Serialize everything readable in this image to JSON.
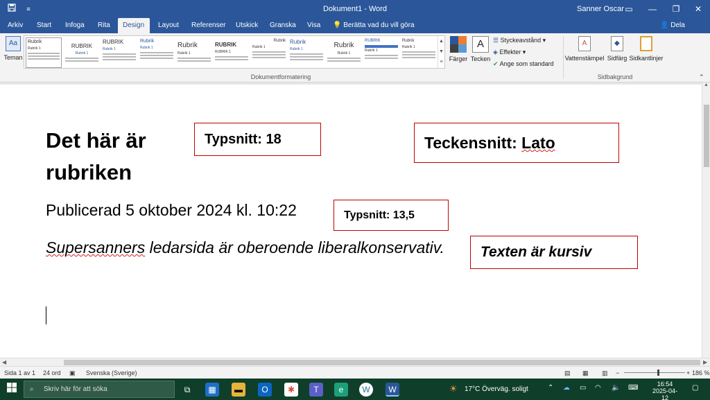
{
  "window": {
    "title": "Dokument1 - Word",
    "user": "Sanner Oscar",
    "icons": {
      "save": "save-icon",
      "customize": "chevron-down-icon"
    }
  },
  "tabs": [
    "Arkiv",
    "Start",
    "Infoga",
    "Rita",
    "Design",
    "Layout",
    "Referenser",
    "Utskick",
    "Granska",
    "Visa"
  ],
  "active_tab": "Design",
  "tell_me": "Berätta vad du vill göra",
  "share": "Dela",
  "ribbon": {
    "themes_label": "Teman",
    "gallery": [
      {
        "title": "Rubrik",
        "sub": "Rubrik 1"
      },
      {
        "title": "RUBRIK",
        "sub": "Rubrik 1"
      },
      {
        "title": "RUBRIK",
        "sub": "Rubrik 1"
      },
      {
        "title": "Rubrik",
        "sub": "Rubrik 1"
      },
      {
        "title": "Rubrik",
        "sub": "Rubrik 1"
      },
      {
        "title": "RUBRIK",
        "sub": "RUBRIK 1"
      },
      {
        "title": "Rubrik",
        "sub": "Rubrik 1"
      },
      {
        "title": "Rubrik",
        "sub": "Rubrik 1"
      },
      {
        "title": "Rubrik",
        "sub": "Rubrik 1"
      },
      {
        "title": "RUBRIK",
        "sub": "Rubrik 1"
      },
      {
        "title": "Rubrik",
        "sub": "Rubrik 1"
      }
    ],
    "colors_label": "Färger",
    "fonts_label": "Tecken",
    "paragraph_spacing": "Styckeavstånd",
    "effects": "Effekter",
    "set_default": "Ange som standard",
    "group_doc_format": "Dokumentformatering",
    "watermark": "Vattenstämpel",
    "page_color": "Sidfärg",
    "page_borders": "Sidkantlinjer",
    "group_page_bg": "Sidbakgrund"
  },
  "document": {
    "heading": "Det här är rubriken",
    "published": "Publicerad 5 oktober 2024 kl. 10:22",
    "quote_misspelled": "Supersanners",
    "quote_rest": " ledarsida är oberoende liberalkonservativ."
  },
  "annotations": {
    "heading_size": "Typsnitt: 18",
    "font_prefix": "Teckensnitt: ",
    "font_name": "Lato",
    "date_size": "Typsnitt: 13,5",
    "italic_note": "Texten är kursiv"
  },
  "status": {
    "page": "Sida 1 av 1",
    "words": "24 ord",
    "language": "Svenska (Sverige)",
    "zoom": "186 %"
  },
  "taskbar": {
    "search": "Skriv här för att söka",
    "weather": "17°C  Överväg. soligt",
    "time": "16:54",
    "date": "2025-04-12"
  },
  "colors": {
    "word_blue": "#2b579a",
    "taskbar": "#0f3f2a",
    "annotation_border": "#c00000"
  }
}
